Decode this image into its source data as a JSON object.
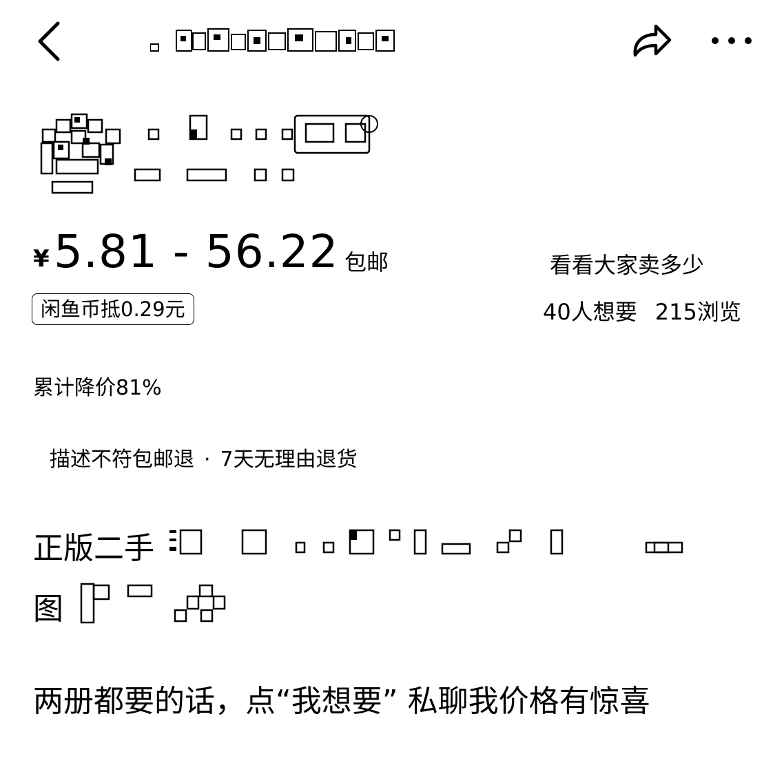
{
  "header": {
    "back_icon": "chevron-left-icon",
    "share_icon": "share-arrow-icon",
    "more_icon": "more-dots-icon"
  },
  "price": {
    "currency_symbol": "¥",
    "range": "5.81 - 56.22",
    "shipping": "包邮"
  },
  "coin_discount": "闲鱼币抵0.29元",
  "price_trend_link": "看看大家卖多少",
  "stats": {
    "wants": "40人想要",
    "views": "215浏览"
  },
  "price_drop": "累计降价81%",
  "guarantee": {
    "item1": "描述不符包邮退",
    "separator": "·",
    "item2": "7天无理由退货"
  },
  "description": {
    "line1_prefix": "正版二手",
    "line2_prefix": "图"
  },
  "promo": "两册都要的话，点“我想要” 私聊我价格有惊喜"
}
